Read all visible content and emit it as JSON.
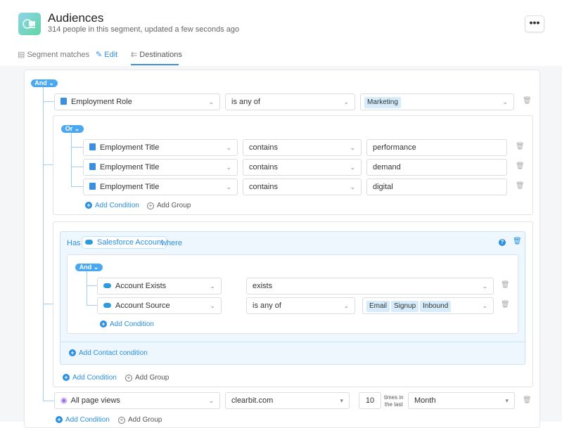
{
  "header": {
    "title": "Audiences",
    "subtitle": "314 people in this segment, updated a few seconds ago",
    "more": "•••"
  },
  "tabs": [
    {
      "label": "Segment matches",
      "icon": "list-icon"
    },
    {
      "label": "Edit",
      "icon": "pencil-icon"
    },
    {
      "label": "Destinations",
      "icon": "destinations-icon",
      "active": true
    }
  ],
  "root": {
    "operator": "And ⌄",
    "row1": {
      "field": "Employment Role",
      "op": "is any of",
      "tags": [
        "Marketing"
      ]
    },
    "or_group": {
      "operator": "Or ⌄",
      "rows": [
        {
          "field": "Employment Title",
          "op": "contains",
          "value": "performance"
        },
        {
          "field": "Employment Title",
          "op": "contains",
          "value": "demand"
        },
        {
          "field": "Employment Title",
          "op": "contains",
          "value": "digital"
        }
      ],
      "add_condition": "Add Condition",
      "add_group": "Add Group"
    },
    "has_group": {
      "has": "Has",
      "object": "Salesforce Account",
      "where": "where",
      "operator": "And ⌄",
      "rows": [
        {
          "field": "Account Exists",
          "op": "exists"
        },
        {
          "field": "Account Source",
          "op": "is any of",
          "tags": [
            "Email",
            "Signup",
            "Inbound"
          ]
        }
      ],
      "add_condition": "Add Condition",
      "add_contact": "Add Contact condition",
      "outer_add_condition": "Add Condition",
      "outer_add_group": "Add Group"
    },
    "pageviews": {
      "field": "All page views",
      "domain": "clearbit.com",
      "count": "10",
      "times_label1": "times in",
      "times_label2": "the last",
      "period": "Month"
    },
    "add_condition": "Add Condition",
    "add_group": "Add Group"
  },
  "colors": {
    "accent": "#3b8fe0",
    "pill": "#4aa8f0",
    "has_bg": "#eef7fe"
  }
}
